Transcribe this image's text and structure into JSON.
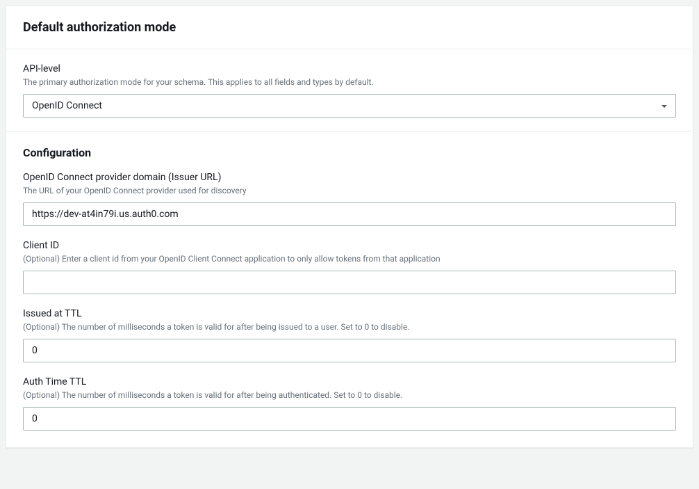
{
  "header": {
    "title": "Default authorization mode"
  },
  "apiLevel": {
    "label": "API-level",
    "description": "The primary authorization mode for your schema. This applies to all fields and types by default.",
    "selectedValue": "OpenID Connect"
  },
  "configuration": {
    "title": "Configuration",
    "issuerUrl": {
      "label": "OpenID Connect provider domain (Issuer URL)",
      "description": "The URL of your OpenID Connect provider used for discovery",
      "value": "https://dev-at4in79i.us.auth0.com"
    },
    "clientId": {
      "label": "Client ID",
      "description": "(Optional) Enter a client id from your OpenID Client Connect application to only allow tokens from that application",
      "value": ""
    },
    "issuedAtTtl": {
      "label": "Issued at TTL",
      "description": "(Optional) The number of milliseconds a token is valid for after being issued to a user. Set to 0 to disable.",
      "value": "0"
    },
    "authTimeTtl": {
      "label": "Auth Time TTL",
      "description": "(Optional) The number of milliseconds a token is valid for after being authenticated. Set to 0 to disable.",
      "value": "0"
    }
  }
}
